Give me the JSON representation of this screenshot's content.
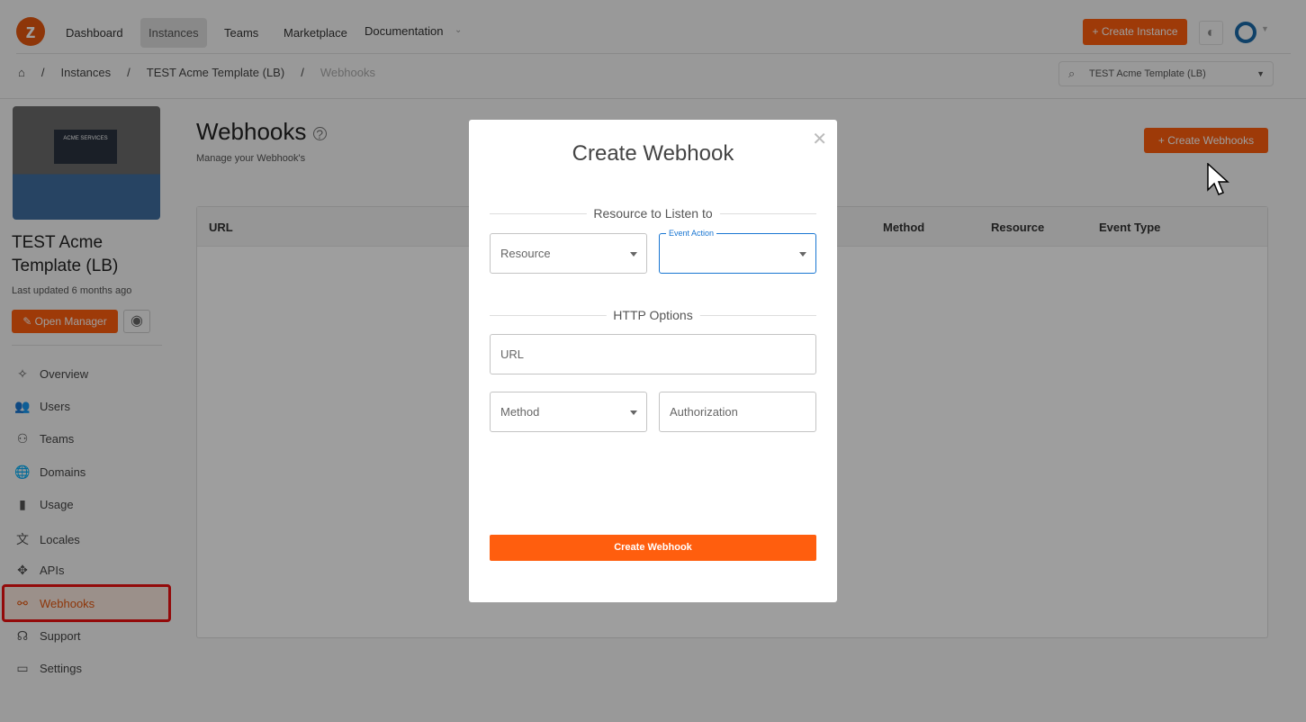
{
  "nav": {
    "items": [
      "Dashboard",
      "Instances",
      "Teams",
      "Marketplace",
      "Documentation"
    ],
    "active": "Instances",
    "create_instance": "Create Instance"
  },
  "breadcrumb": [
    "Instances",
    "TEST Acme Template (LB)",
    "Webhooks"
  ],
  "instance_select": "TEST Acme Template (LB)",
  "instance": {
    "title": "TEST Acme Template (LB)",
    "updated": "Last updated 6 months ago",
    "open_manager": "Open Manager",
    "thumb_heading": "ACME SERVICES"
  },
  "sidebar": [
    "Overview",
    "Users",
    "Teams",
    "Domains",
    "Usage",
    "Locales",
    "APIs",
    "Webhooks",
    "Support",
    "Settings"
  ],
  "page": {
    "title": "Webhooks",
    "subtitle": "Manage your Webhook's",
    "create_button": "Create Webhooks",
    "columns": [
      "URL",
      "Method",
      "Resource",
      "Event Type"
    ]
  },
  "modal": {
    "title": "Create Webhook",
    "section1": "Resource to Listen to",
    "resource_placeholder": "Resource",
    "event_action_label": "Event Action",
    "section2": "HTTP Options",
    "url_placeholder": "URL",
    "method_placeholder": "Method",
    "authorization_placeholder": "Authorization",
    "submit": "Create Webhook"
  },
  "colors": {
    "accent": "#ff5e0e",
    "focus": "#1976d2",
    "highlight": "#e11"
  }
}
